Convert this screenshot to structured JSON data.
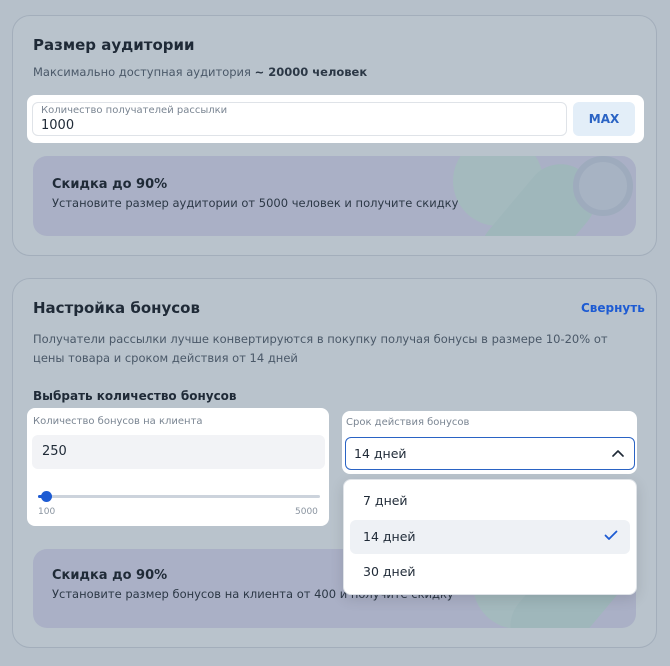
{
  "audience": {
    "title": "Размер аудитории",
    "subtitle_prefix": "Максимально доступная аудитория",
    "subtitle_value": "~ 20000 человек",
    "recipients_label": "Количество получателей рассылки",
    "recipients_value": "1000",
    "max_button": "MAX",
    "promo_title": "Скидка до 90%",
    "promo_text": "Установите размер аудитории от 5000 человек и получите скидку"
  },
  "bonuses": {
    "title": "Настройка бонусов",
    "collapse_link": "Свернуть",
    "description": "Получатели рассылки лучше конвертируются в покупку получая бонусы в размере 10-20% от цены товара и сроком действия от 14 дней",
    "choose_label": "Выбрать количество бонусов",
    "per_client_label": "Количество бонусов на клиента",
    "per_client_value": "250",
    "slider_min": "100",
    "slider_max": "5000",
    "slider_fraction": 0.031,
    "validity_label": "Срок действия бонусов",
    "validity_selected": "14 дней",
    "validity_options": [
      "7 дней",
      "14 дней",
      "30 дней"
    ],
    "promo_title": "Скидка до 90%",
    "promo_text": "Установите размер бонусов на клиента от 400 и получите скидку"
  },
  "colors": {
    "accent": "#1d5bd3",
    "overlay": "#b6c0ca",
    "promo_bg": "#aab0c6"
  }
}
